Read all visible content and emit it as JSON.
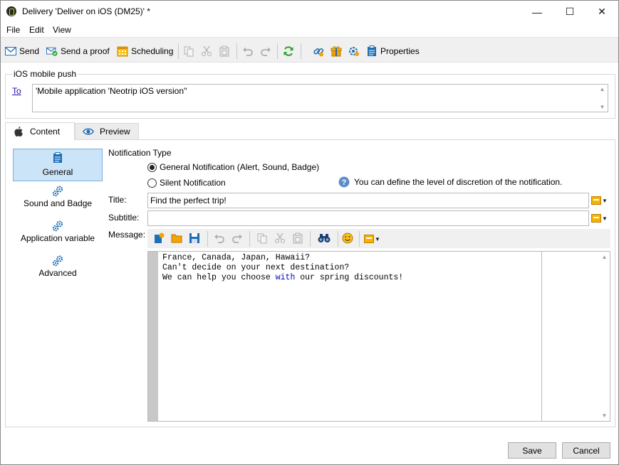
{
  "window": {
    "title": "Delivery 'Deliver on iOS (DM25)' *",
    "minimize_glyph": "—",
    "maximize_glyph": "☐",
    "close_glyph": "✕"
  },
  "menu": {
    "file": "File",
    "edit": "Edit",
    "view": "View"
  },
  "toolbar": {
    "send_label": "Send",
    "send_proof_label": "Send a proof",
    "scheduling_label": "Scheduling",
    "properties_label": "Properties"
  },
  "target_group": {
    "label": "iOS mobile push",
    "to_link": "To",
    "to_value": "'Mobile application 'Neotrip iOS version''"
  },
  "tabs": {
    "content": "Content",
    "preview": "Preview"
  },
  "sidebar": {
    "items": [
      {
        "label": "General",
        "icon": "clipboard-icon"
      },
      {
        "label": "Sound and Badge",
        "icon": "gears-icon"
      },
      {
        "label": "Application variable",
        "icon": "gears-icon"
      },
      {
        "label": "Advanced",
        "icon": "gears-icon"
      }
    ]
  },
  "form": {
    "notification_type_label": "Notification Type",
    "general_notification": "General Notification (Alert, Sound, Badge)",
    "silent_notification": "Silent Notification",
    "selected_notification": "general",
    "help_text": "You can define the level of discretion of the notification.",
    "title_label": "Title:",
    "title_value": "Find the perfect trip!",
    "subtitle_label": "Subtitle:",
    "subtitle_value": "",
    "message_label": "Message:",
    "message_lines": [
      "France, Canada, Japan, Hawaii?",
      "Can't decide on your next destination?",
      "We can help you choose ",
      "with",
      " our spring discounts!"
    ]
  },
  "footer": {
    "save": "Save",
    "cancel": "Cancel"
  },
  "colors": {
    "accent_selected": "#cce4f7",
    "link": "#1a0dab",
    "keyword": "#0000cc",
    "icon_blue": "#1e6fb5",
    "icon_green": "#2ca02c",
    "icon_orange": "#f4a300"
  }
}
